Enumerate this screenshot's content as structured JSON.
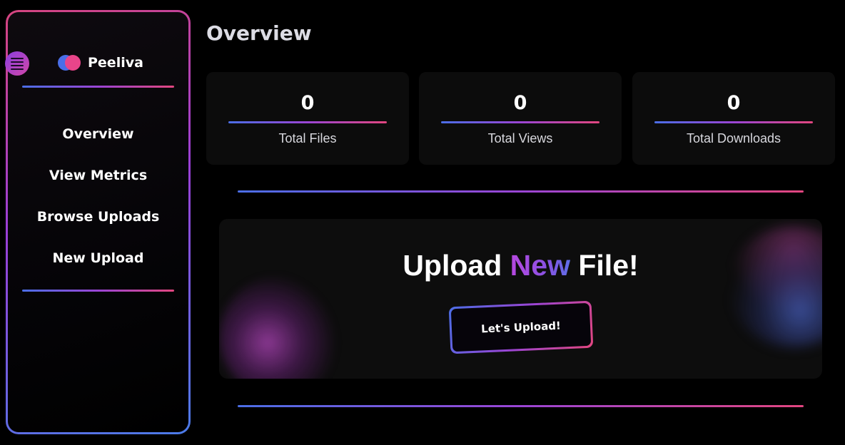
{
  "app": {
    "name": "Peeliva"
  },
  "sidebar": {
    "items": [
      {
        "label": "Overview"
      },
      {
        "label": "View Metrics"
      },
      {
        "label": "Browse Uploads"
      },
      {
        "label": "New Upload"
      }
    ]
  },
  "main": {
    "title": "Overview",
    "stats": [
      {
        "value": "0",
        "label": "Total Files"
      },
      {
        "value": "0",
        "label": "Total Views"
      },
      {
        "value": "0",
        "label": "Total Downloads"
      }
    ],
    "upload": {
      "heading_prefix": "Upload",
      "heading_accent": "New",
      "heading_suffix": "File!",
      "button_label": "Let's Upload!"
    }
  },
  "colors": {
    "background": "#000000",
    "card": "#0c0c0c",
    "gradient_start": "#4b6ee6",
    "gradient_mid": "#9a45d4",
    "gradient_end": "#e2467f"
  },
  "icons": {
    "menu": "hamburger-menu-icon",
    "logo": "brand-logo-icon"
  }
}
